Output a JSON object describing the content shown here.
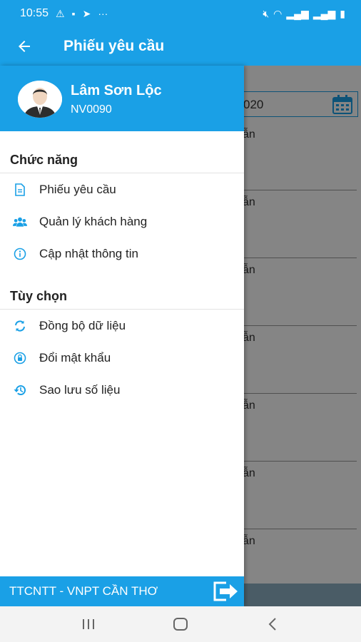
{
  "status": {
    "time": "10:55",
    "dots": "···"
  },
  "appbar": {
    "title": "Phiếu yêu cầu"
  },
  "background": {
    "date_partial": "020",
    "row_text": "ẫn"
  },
  "user": {
    "name": "Lâm Sơn Lộc",
    "id": "NV0090"
  },
  "sections": {
    "functions": {
      "title": "Chức năng",
      "items": [
        {
          "label": "Phiếu yêu cầu",
          "icon": "document-icon"
        },
        {
          "label": "Quản lý khách hàng",
          "icon": "people-icon"
        },
        {
          "label": "Cập nhật thông tin",
          "icon": "info-icon"
        }
      ]
    },
    "options": {
      "title": "Tùy chọn",
      "items": [
        {
          "label": "Đồng bộ dữ liệu",
          "icon": "sync-icon"
        },
        {
          "label": "Đổi mật khẩu",
          "icon": "lock-icon"
        },
        {
          "label": "Sao lưu số liệu",
          "icon": "backup-icon"
        }
      ]
    }
  },
  "footer": {
    "org": "TTCNTT - VNPT CẦN THƠ"
  },
  "colors": {
    "primary": "#1aa0e6",
    "icon": "#1aa0e6"
  }
}
